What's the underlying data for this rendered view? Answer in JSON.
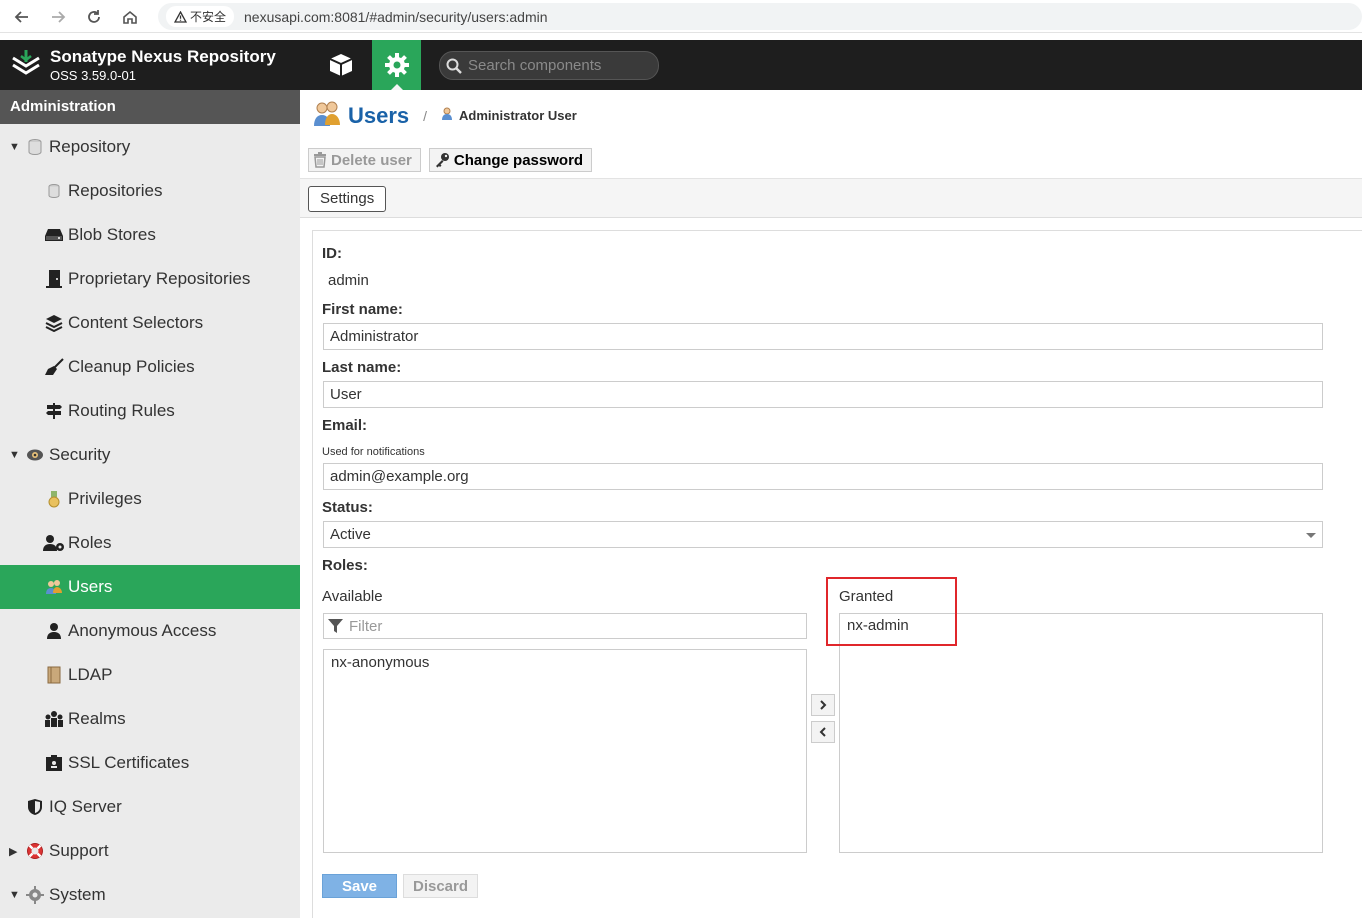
{
  "browser": {
    "insecure_label": "不安全",
    "url": "nexusapi.com:8081/#admin/security/users:admin"
  },
  "header": {
    "brand_title": "Sonatype Nexus Repository",
    "brand_version": "OSS 3.59.0-01",
    "search_placeholder": "Search components",
    "accent_color": "#2aa65a"
  },
  "sidebar": {
    "heading": "Administration",
    "items": [
      {
        "label": "Repository",
        "icon": "database-icon",
        "group": true,
        "expanded": true
      },
      {
        "label": "Repositories",
        "icon": "database-icon"
      },
      {
        "label": "Blob Stores",
        "icon": "hdd-icon"
      },
      {
        "label": "Proprietary Repositories",
        "icon": "door-icon"
      },
      {
        "label": "Content Selectors",
        "icon": "layers-icon"
      },
      {
        "label": "Cleanup Policies",
        "icon": "broom-icon"
      },
      {
        "label": "Routing Rules",
        "icon": "signpost-icon"
      },
      {
        "label": "Security",
        "icon": "shield-eye-icon",
        "group": true,
        "expanded": true
      },
      {
        "label": "Privileges",
        "icon": "medal-icon"
      },
      {
        "label": "Roles",
        "icon": "user-gear-icon"
      },
      {
        "label": "Users",
        "icon": "users-icon",
        "active": true
      },
      {
        "label": "Anonymous Access",
        "icon": "user-icon"
      },
      {
        "label": "LDAP",
        "icon": "book-icon"
      },
      {
        "label": "Realms",
        "icon": "realm-icon"
      },
      {
        "label": "SSL Certificates",
        "icon": "certificate-icon"
      },
      {
        "label": "IQ Server",
        "icon": "shield-icon"
      },
      {
        "label": "Support",
        "icon": "lifebuoy-icon",
        "group": true,
        "expanded": false
      },
      {
        "label": "System",
        "icon": "gear-icon",
        "group": true,
        "expanded": true
      }
    ]
  },
  "main": {
    "title": "Users",
    "breadcrumb": "Administrator User",
    "toolbar": {
      "delete_label": "Delete user",
      "change_password_label": "Change password"
    },
    "tab_settings": "Settings",
    "form": {
      "id_label": "ID:",
      "id_value": "admin",
      "first_name_label": "First name:",
      "first_name_value": "Administrator",
      "last_name_label": "Last name:",
      "last_name_value": "User",
      "email_label": "Email:",
      "email_help": "Used for notifications",
      "email_value": "admin@example.org",
      "status_label": "Status:",
      "status_value": "Active",
      "roles_label": "Roles:",
      "available_label": "Available",
      "filter_placeholder": "Filter",
      "available_roles": [
        "nx-anonymous"
      ],
      "granted_label": "Granted",
      "granted_roles": [
        "nx-admin"
      ],
      "save_label": "Save",
      "discard_label": "Discard"
    }
  }
}
